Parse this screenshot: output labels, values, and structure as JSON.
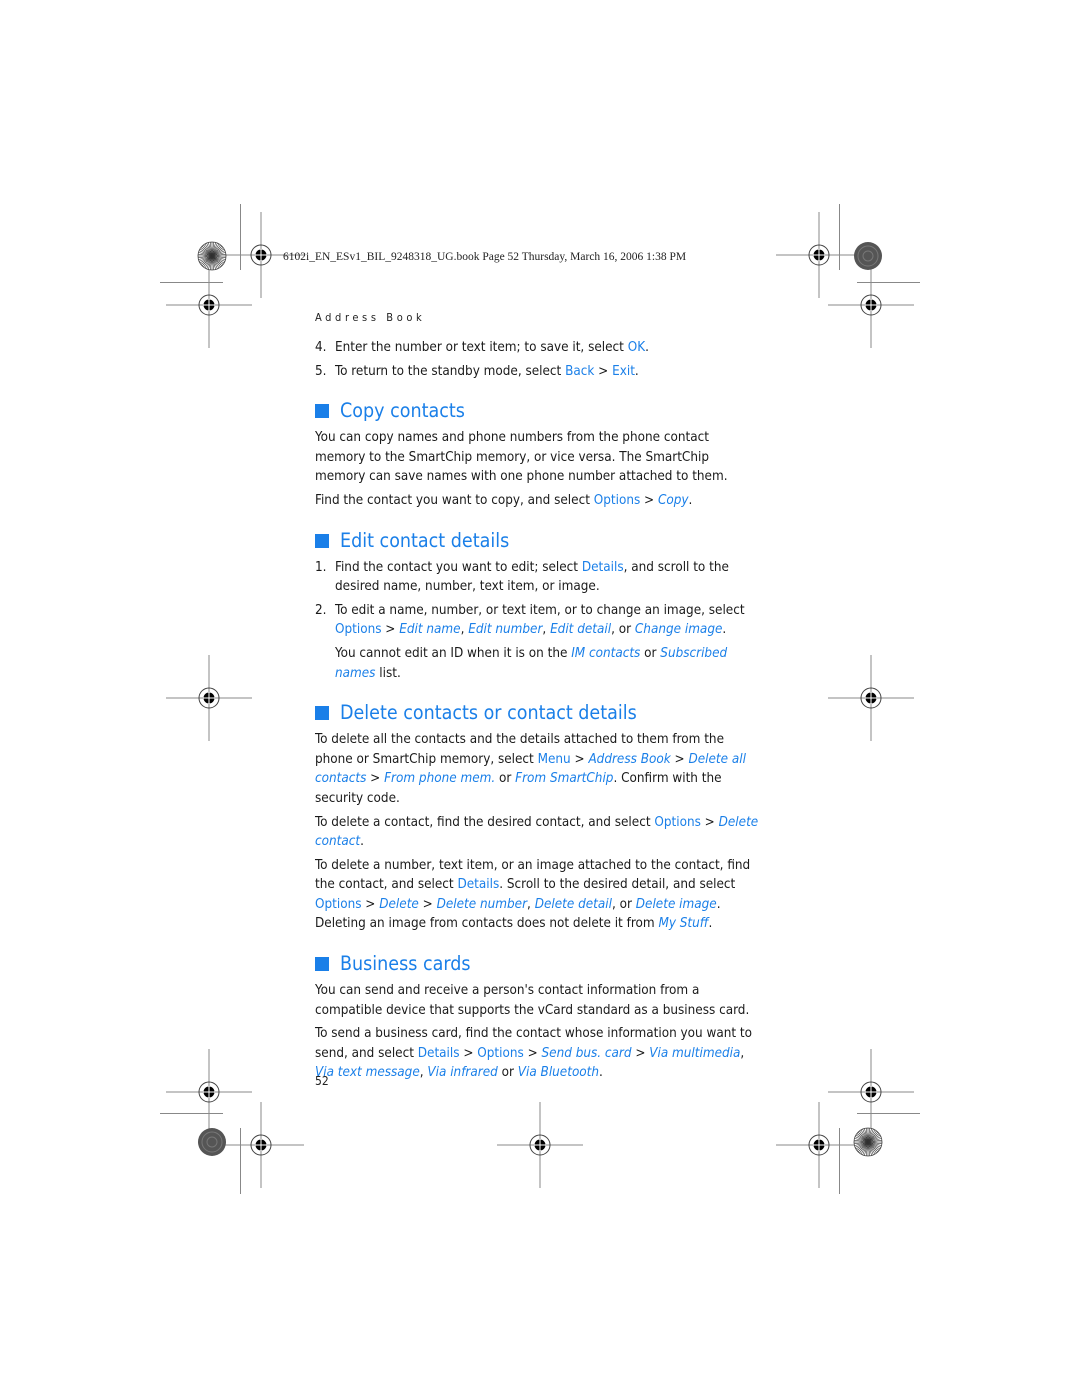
{
  "print_header": {
    "file_info": "6102i_EN_ESv1_BIL_9248318_UG.book  Page 52  Thursday, March 16, 2006  1:38 PM"
  },
  "running_head": "Address Book",
  "steps_top": [
    {
      "num": "4.",
      "parts": [
        {
          "t": "Enter the number or text item; to save it, select "
        },
        {
          "t": "OK",
          "s": "k"
        },
        {
          "t": "."
        }
      ]
    },
    {
      "num": "5.",
      "parts": [
        {
          "t": "To return to the standby mode, select "
        },
        {
          "t": "Back",
          "s": "k"
        },
        {
          "t": " > "
        },
        {
          "t": "Exit",
          "s": "k"
        },
        {
          "t": "."
        }
      ]
    }
  ],
  "sections": {
    "copy": {
      "title": "Copy contacts",
      "p1": "You can copy names and phone numbers from the phone contact memory to the SmartChip memory, or vice versa. The SmartChip memory can save names with one phone number attached to them.",
      "p2": [
        {
          "t": "Find the contact you want to copy, and select "
        },
        {
          "t": "Options",
          "s": "k"
        },
        {
          "t": " > "
        },
        {
          "t": "Copy",
          "s": "i"
        },
        {
          "t": "."
        }
      ]
    },
    "edit": {
      "title": "Edit contact details",
      "steps": [
        {
          "num": "1.",
          "parts": [
            {
              "t": "Find the contact you want to edit; select "
            },
            {
              "t": "Details",
              "s": "k"
            },
            {
              "t": ", and scroll to the desired name, number, text item, or image."
            }
          ]
        },
        {
          "num": "2.",
          "parts": [
            {
              "t": "To edit a name, number, or text item, or to change an image, select "
            },
            {
              "t": "Options",
              "s": "k"
            },
            {
              "t": " > "
            },
            {
              "t": "Edit name",
              "s": "i"
            },
            {
              "t": ", "
            },
            {
              "t": "Edit number",
              "s": "i"
            },
            {
              "t": ", "
            },
            {
              "t": "Edit detail",
              "s": "i"
            },
            {
              "t": ", or "
            },
            {
              "t": "Change image",
              "s": "i"
            },
            {
              "t": "."
            }
          ]
        }
      ],
      "note": [
        {
          "t": "You cannot edit an ID when it is on the "
        },
        {
          "t": "IM contacts",
          "s": "i"
        },
        {
          "t": " or "
        },
        {
          "t": "Subscribed names",
          "s": "i"
        },
        {
          "t": " list."
        }
      ]
    },
    "delete": {
      "title": "Delete contacts or contact details",
      "p1": [
        {
          "t": "To delete all the contacts and the details attached to them from the phone or SmartChip memory, select "
        },
        {
          "t": "Menu",
          "s": "k"
        },
        {
          "t": " > "
        },
        {
          "t": "Address Book",
          "s": "i"
        },
        {
          "t": " > "
        },
        {
          "t": "Delete all contacts",
          "s": "i"
        },
        {
          "t": " > "
        },
        {
          "t": "From phone mem.",
          "s": "i"
        },
        {
          "t": " or "
        },
        {
          "t": "From SmartChip",
          "s": "i"
        },
        {
          "t": ". Confirm with the security code."
        }
      ],
      "p2": [
        {
          "t": "To delete a contact, find the desired contact, and select "
        },
        {
          "t": "Options",
          "s": "k"
        },
        {
          "t": " > "
        },
        {
          "t": "Delete contact",
          "s": "i"
        },
        {
          "t": "."
        }
      ],
      "p3": [
        {
          "t": "To delete a number, text item, or an image attached to the contact, find the contact, and select "
        },
        {
          "t": "Details",
          "s": "k"
        },
        {
          "t": ". Scroll to the desired detail, and select "
        },
        {
          "t": "Options",
          "s": "k"
        },
        {
          "t": " > "
        },
        {
          "t": "Delete",
          "s": "i"
        },
        {
          "t": " > "
        },
        {
          "t": "Delete number",
          "s": "i"
        },
        {
          "t": ", "
        },
        {
          "t": "Delete detail",
          "s": "i"
        },
        {
          "t": ", or "
        },
        {
          "t": "Delete image",
          "s": "i"
        },
        {
          "t": ". Deleting an image from contacts does not delete it from "
        },
        {
          "t": "My Stuff",
          "s": "i"
        },
        {
          "t": "."
        }
      ]
    },
    "business": {
      "title": "Business cards",
      "p1": "You can send and receive a person's contact information from a compatible device that supports the vCard standard as a business card.",
      "p2": [
        {
          "t": "To send a business card, find the contact whose information you want to send, and select "
        },
        {
          "t": "Details",
          "s": "k"
        },
        {
          "t": " > "
        },
        {
          "t": "Options",
          "s": "k"
        },
        {
          "t": " > "
        },
        {
          "t": "Send bus. card",
          "s": "i"
        },
        {
          "t": " > "
        },
        {
          "t": "Via multimedia",
          "s": "i"
        },
        {
          "t": ", "
        },
        {
          "t": "Via text message",
          "s": "i"
        },
        {
          "t": ", "
        },
        {
          "t": "Via infrared",
          "s": "i"
        },
        {
          "t": " or "
        },
        {
          "t": "Via Bluetooth",
          "s": "i"
        },
        {
          "t": "."
        }
      ]
    }
  },
  "page_number": "52",
  "colors": {
    "accent": "#1a7fe8",
    "text": "#1a1a1a"
  }
}
